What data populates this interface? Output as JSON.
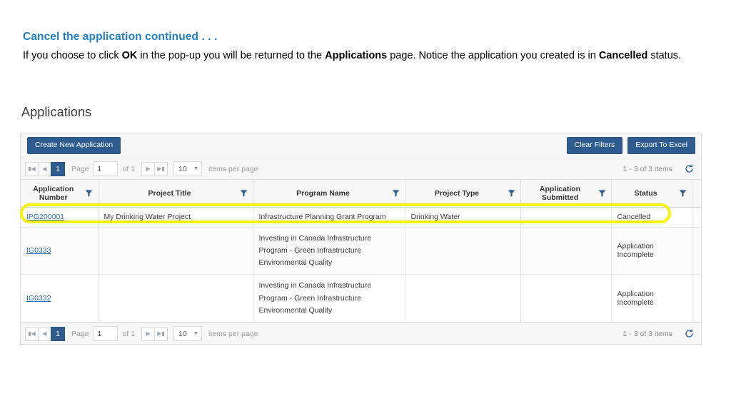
{
  "slide": {
    "title": "Cancel the application continued . . .",
    "body_parts": [
      {
        "t": "If you choose to click ",
        "b": false
      },
      {
        "t": "OK",
        "b": true
      },
      {
        "t": " in the pop-up you will be returned to the ",
        "b": false
      },
      {
        "t": "Applications",
        "b": true
      },
      {
        "t": " page. Notice the application you created is in ",
        "b": false
      },
      {
        "t": "Cancelled",
        "b": true
      },
      {
        "t": " status.",
        "b": false
      }
    ],
    "body_plain": "If you choose to click OK in the pop-up you will be returned to the Applications page. Notice the application you created is in Cancelled status."
  },
  "section": {
    "title": "Applications"
  },
  "toolbar": {
    "create_label": "Create New Application",
    "clear_filters_label": "Clear Filters",
    "export_label": "Export To Excel"
  },
  "pager": {
    "first_icon": "first-page-icon",
    "prev_icon": "previous-page-icon",
    "next_icon": "next-page-icon",
    "last_icon": "last-page-icon",
    "current_page_button": "1",
    "page_label": "Page",
    "page_value": "1",
    "of_label": "of 1",
    "page_size_value": "10",
    "items_per_page_label": "items per page",
    "item_count": "1 - 3 of 3 items",
    "refresh_icon": "refresh-icon"
  },
  "table": {
    "columns": [
      {
        "label": "Application Number",
        "filter": "filter-icon"
      },
      {
        "label": "Project Title",
        "filter": "filter-icon"
      },
      {
        "label": "Program Name",
        "filter": "filter-icon"
      },
      {
        "label": "Project Type",
        "filter": "filter-icon"
      },
      {
        "label": "Application Submitted",
        "filter": "filter-icon"
      },
      {
        "label": "Status",
        "filter": "filter-icon"
      }
    ],
    "rows": [
      {
        "application_number": "IPG200001",
        "project_title": "My Drinking Water Project",
        "program_name": "Infrastructure Planning Grant Program",
        "project_type": "Drinking Water",
        "application_submitted": "",
        "status": "Cancelled",
        "highlighted": true
      },
      {
        "application_number": "IG0333",
        "project_title": "",
        "program_name": "Investing in Canada Infrastructure Program - Green Infrastructure Environmental Quality",
        "project_type": "",
        "application_submitted": "",
        "status": "Application Incomplete",
        "highlighted": false
      },
      {
        "application_number": "IG0332",
        "project_title": "",
        "program_name": "Investing in Canada Infrastructure Program - Green Infrastructure Environmental Quality",
        "project_type": "",
        "application_submitted": "",
        "status": "Application Incomplete",
        "highlighted": false
      }
    ]
  },
  "colors": {
    "title_blue": "#1F7FC4",
    "button_blue": "#2f5c8f",
    "link_blue": "#2f6fb0",
    "highlight_yellow": "#F9F30B",
    "panel_grey": "#f7f7f7"
  }
}
